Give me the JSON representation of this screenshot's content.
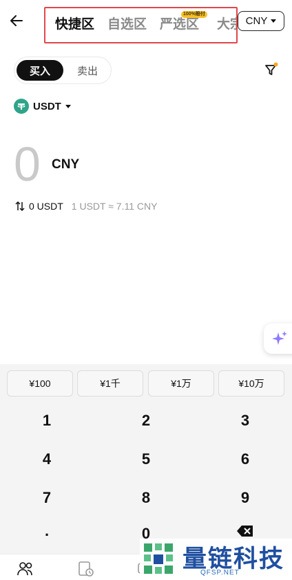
{
  "header": {
    "tabs": [
      {
        "label": "快捷区",
        "active": true
      },
      {
        "label": "自选区",
        "active": false
      },
      {
        "label": "严选区",
        "active": false,
        "badge": "100%赔付"
      },
      {
        "label": "大宗",
        "active": false
      }
    ],
    "currency": "CNY"
  },
  "trade": {
    "buy_label": "买入",
    "sell_label": "卖出",
    "coin": "USDT"
  },
  "amount": {
    "value": "0",
    "currency": "CNY",
    "converted": "0 USDT",
    "rate": "1 USDT ≈ 7.11 CNY"
  },
  "quick_amounts": [
    "¥100",
    "¥1千",
    "¥1万",
    "¥10万"
  ],
  "keys": [
    "1",
    "2",
    "3",
    "4",
    "5",
    "6",
    "7",
    "8",
    "9",
    ".",
    "0"
  ],
  "icons": {
    "back": "arrow-left-icon",
    "filter": "filter-icon",
    "coin": "tether-icon",
    "ai": "sparkle-icon",
    "delete": "backspace-icon"
  },
  "watermark": {
    "title": "量链科技",
    "subtitle": "QFSP.NET"
  },
  "colors": {
    "accent": "#111111",
    "highlight": "#e0464b",
    "badge": "#f6c02a",
    "tether": "#2fa48a"
  }
}
